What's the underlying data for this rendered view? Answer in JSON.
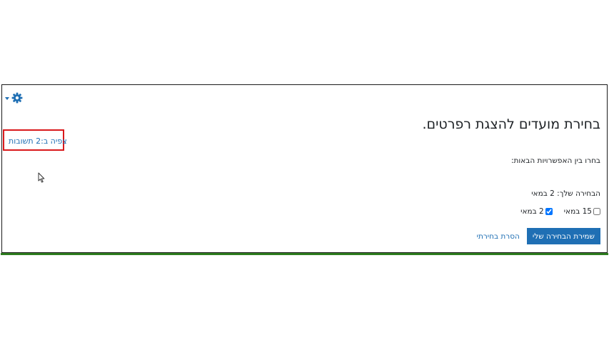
{
  "header": {
    "settings_icon": "gear-icon",
    "menu_caret_icon": "caret-down-icon"
  },
  "choice": {
    "title": "בחירת מועדים להצגת רפרטים.",
    "view_responses_link": "צפיה ב:2 תשובות",
    "instructions": "בחרו בין האפשרויות הבאות:",
    "your_choice": "הבחירה שלך: 2 במאי",
    "options": [
      {
        "label": "2 במאי",
        "checked": true
      },
      {
        "label": "15 במאי",
        "checked": false
      }
    ],
    "save_button": "שמירת הבחירה שלי",
    "remove_link": "הסרת בחירתי"
  },
  "colors": {
    "link": "#1f6fb4",
    "button_bg": "#1f6fb4",
    "highlight_box": "#d9191c",
    "bottom_line": "#2e7d1f"
  }
}
